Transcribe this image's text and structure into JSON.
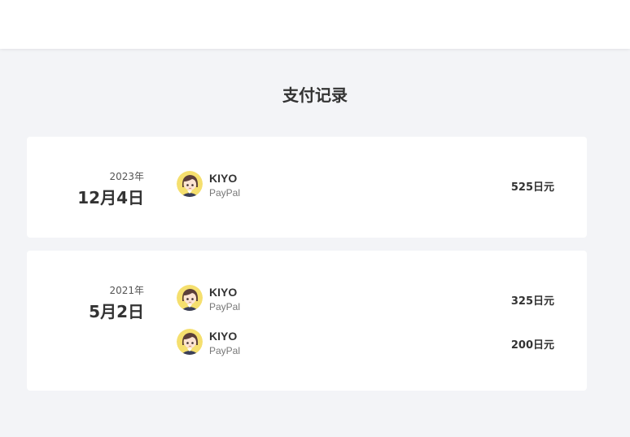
{
  "header": {},
  "page_title": "支付记录",
  "groups": [
    {
      "year": "2023年",
      "day": "12月4日",
      "entries": [
        {
          "name": "KIYO",
          "method": "PayPal",
          "amount": "525日元",
          "avatar_icon": "anime-girl-avatar-icon"
        }
      ]
    },
    {
      "year": "2021年",
      "day": "5月2日",
      "entries": [
        {
          "name": "KIYO",
          "method": "PayPal",
          "amount": "325日元",
          "avatar_icon": "anime-girl-avatar-icon"
        },
        {
          "name": "KIYO",
          "method": "PayPal",
          "amount": "200日元",
          "avatar_icon": "anime-girl-avatar-icon"
        }
      ]
    }
  ],
  "colors": {
    "background": "#f3f4f7",
    "card": "#ffffff",
    "text": "#333333",
    "muted": "#777777",
    "avatar_bg": "#f5df6e"
  }
}
